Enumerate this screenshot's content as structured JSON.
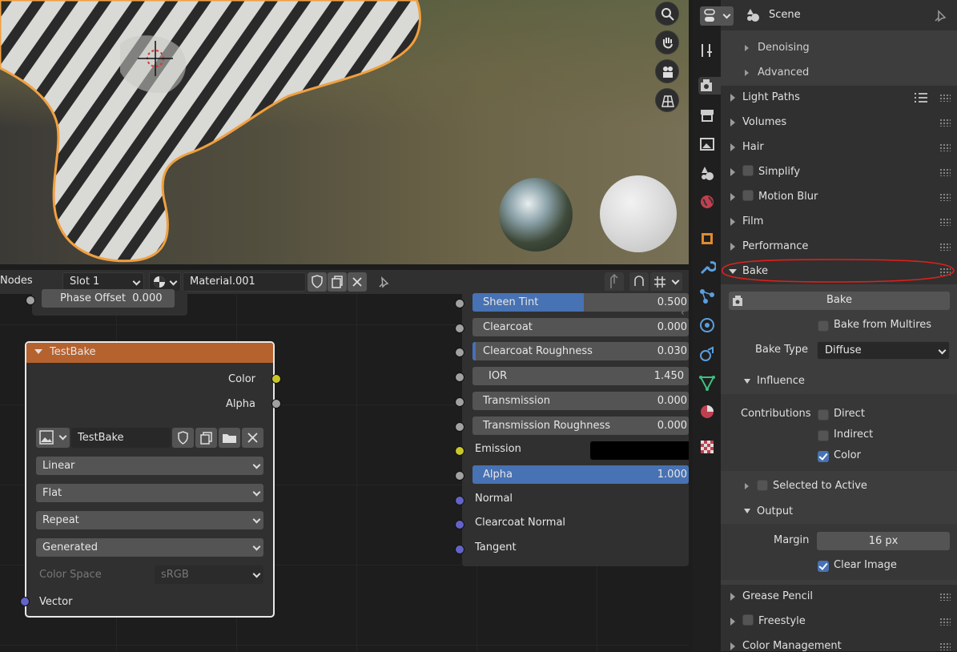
{
  "node_editor": {
    "editor_type": "Nodes",
    "slot": "Slot 1",
    "material": "Material.001",
    "phase_offset_label": "Phase Offset",
    "phase_offset_value": "0.000",
    "image_node": {
      "title": "TestBake",
      "outputs": [
        "Color",
        "Alpha"
      ],
      "image_name": "TestBake",
      "interpolation": "Linear",
      "projection": "Flat",
      "extension": "Repeat",
      "source": "Generated",
      "color_space_label": "Color Space",
      "color_space_value": "sRGB",
      "input": "Vector"
    },
    "bsdf_inputs": [
      {
        "label": "Sheen Tint",
        "value": "0.500",
        "fill": 0.5
      },
      {
        "label": "Clearcoat",
        "value": "0.000",
        "fill": 0.0
      },
      {
        "label": "Clearcoat Roughness",
        "value": "0.030",
        "fill": 0.03
      },
      {
        "label": "IOR",
        "value": "1.450",
        "fill": 0.0
      },
      {
        "label": "Transmission",
        "value": "0.000",
        "fill": 0.0
      },
      {
        "label": "Transmission Roughness",
        "value": "0.000",
        "fill": 0.0
      }
    ],
    "emission_label": "Emission",
    "emission_color": "#000000",
    "alpha": {
      "label": "Alpha",
      "value": "1.000",
      "fill": 1.0
    },
    "vector_inputs": [
      "Normal",
      "Clearcoat Normal",
      "Tangent"
    ]
  },
  "properties": {
    "scene_label": "Scene",
    "render_subpanels": [
      "Denoising",
      "Advanced"
    ],
    "panels": [
      {
        "label": "Light Paths",
        "checkbox": false
      },
      {
        "label": "Volumes",
        "checkbox": false
      },
      {
        "label": "Hair",
        "checkbox": false
      },
      {
        "label": "Simplify",
        "checkbox": true
      },
      {
        "label": "Motion Blur",
        "checkbox": true
      },
      {
        "label": "Film",
        "checkbox": false
      },
      {
        "label": "Performance",
        "checkbox": false
      }
    ],
    "bake": {
      "title": "Bake",
      "button": "Bake",
      "bake_from_multires": "Bake from Multires",
      "bake_type_label": "Bake Type",
      "bake_type_value": "Diffuse",
      "influence_label": "Influence",
      "contributions_label": "Contributions",
      "direct": "Direct",
      "indirect": "Indirect",
      "color": "Color",
      "selected_to_active": "Selected to Active",
      "output_label": "Output",
      "margin_label": "Margin",
      "margin_value": "16 px",
      "clear_image": "Clear Image"
    },
    "bottom_panels": [
      {
        "label": "Grease Pencil",
        "checkbox": false
      },
      {
        "label": "Freestyle",
        "checkbox": true
      },
      {
        "label": "Color Management",
        "checkbox": false
      }
    ]
  },
  "colors": {
    "accent": "#4772b3",
    "selection_outline": "#f0a040",
    "node_header": "#b5622f",
    "annotation": "#e0201a"
  }
}
